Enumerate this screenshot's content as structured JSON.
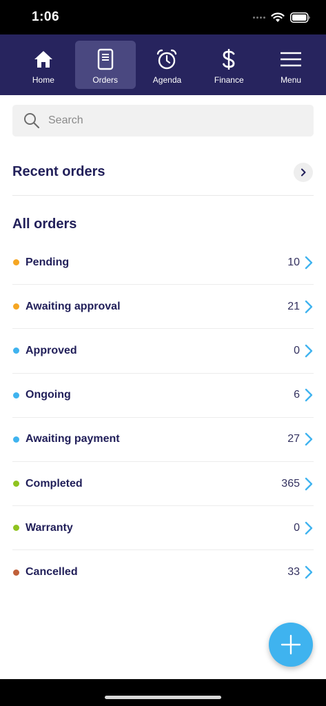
{
  "status_bar": {
    "time": "1:06"
  },
  "nav": {
    "items": [
      {
        "label": "Home",
        "icon": "home-icon",
        "active": false
      },
      {
        "label": "Orders",
        "icon": "orders-icon",
        "active": true
      },
      {
        "label": "Agenda",
        "icon": "alarm-clock-icon",
        "active": false
      },
      {
        "label": "Finance",
        "icon": "dollar-icon",
        "active": false
      },
      {
        "label": "Menu",
        "icon": "hamburger-icon",
        "active": false
      }
    ]
  },
  "search": {
    "placeholder": "Search"
  },
  "recent_orders": {
    "title": "Recent orders"
  },
  "all_orders": {
    "title": "All orders",
    "items": [
      {
        "label": "Pending",
        "count": "10",
        "color": "#f5a623"
      },
      {
        "label": "Awaiting approval",
        "count": "21",
        "color": "#f5a623"
      },
      {
        "label": "Approved",
        "count": "0",
        "color": "#3fb3ef"
      },
      {
        "label": "Ongoing",
        "count": "6",
        "color": "#3fb3ef"
      },
      {
        "label": "Awaiting payment",
        "count": "27",
        "color": "#3fb3ef"
      },
      {
        "label": "Completed",
        "count": "365",
        "color": "#8fc31f"
      },
      {
        "label": "Warranty",
        "count": "0",
        "color": "#8fc31f"
      },
      {
        "label": "Cancelled",
        "count": "33",
        "color": "#c0603a"
      }
    ]
  },
  "colors": {
    "nav_background": "#27245e",
    "nav_active": "#4a4880",
    "text_primary": "#22205a",
    "accent": "#3fb3ef"
  }
}
